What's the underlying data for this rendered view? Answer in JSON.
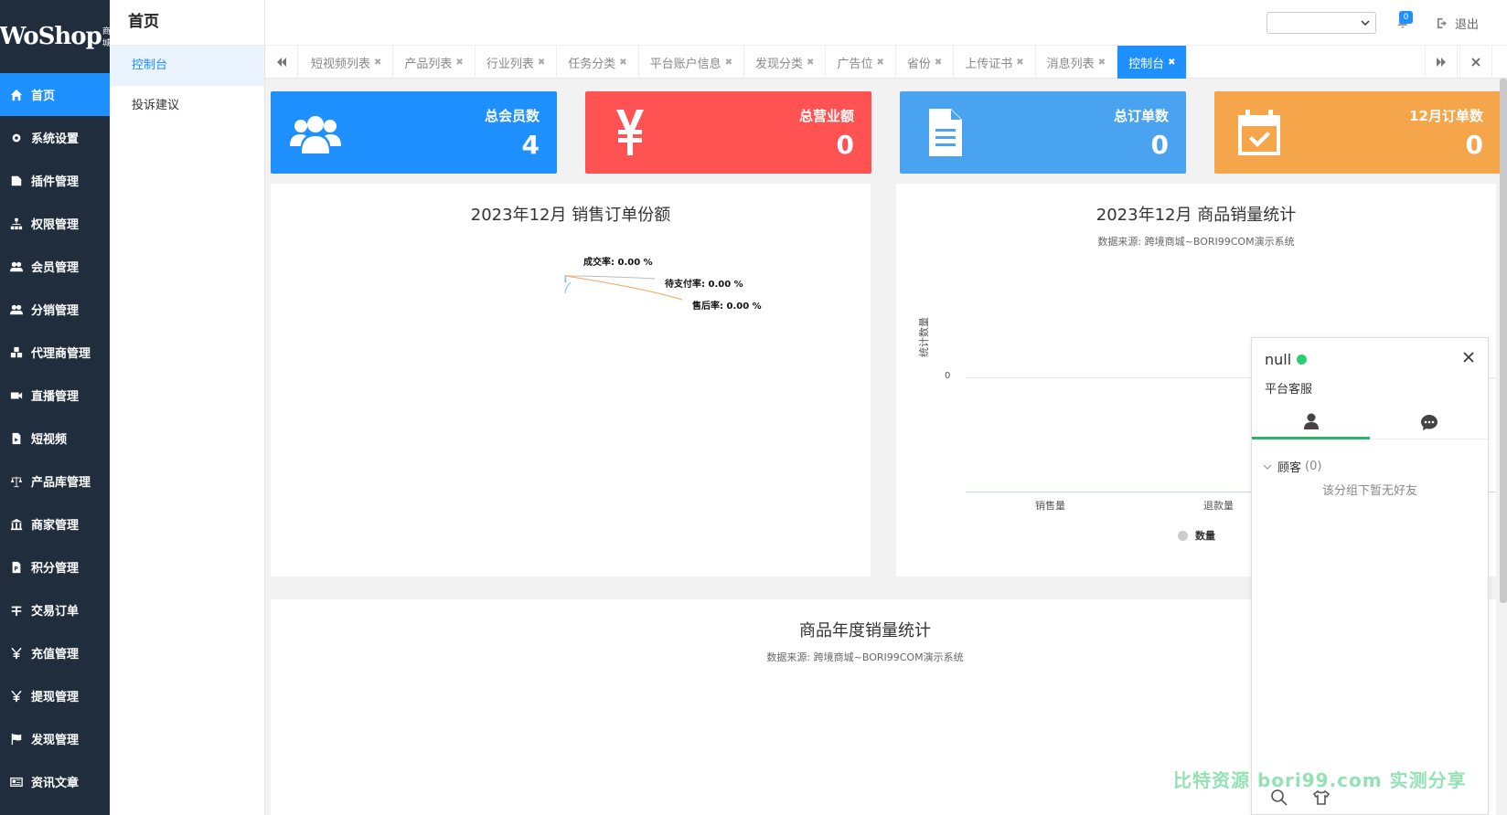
{
  "logo": {
    "text": "WoShop",
    "sub": "商城"
  },
  "sidebar": {
    "items": [
      {
        "label": "首页",
        "icon": "home-icon"
      },
      {
        "label": "系统设置",
        "icon": "gear-icon"
      },
      {
        "label": "插件管理",
        "icon": "plugin-icon"
      },
      {
        "label": "权限管理",
        "icon": "sitemap-icon"
      },
      {
        "label": "会员管理",
        "icon": "users-icon"
      },
      {
        "label": "分销管理",
        "icon": "users-icon"
      },
      {
        "label": "代理商管理",
        "icon": "cubes-icon"
      },
      {
        "label": "直播管理",
        "icon": "video-icon"
      },
      {
        "label": "短视频",
        "icon": "file-video-icon"
      },
      {
        "label": "产品库管理",
        "icon": "scale-icon"
      },
      {
        "label": "商家管理",
        "icon": "bank-icon"
      },
      {
        "label": "积分管理",
        "icon": "points-icon"
      },
      {
        "label": "交易订单",
        "icon": "order-icon"
      },
      {
        "label": "充值管理",
        "icon": "yen-icon"
      },
      {
        "label": "提现管理",
        "icon": "yen-icon"
      },
      {
        "label": "发现管理",
        "icon": "flag-icon"
      },
      {
        "label": "资讯文章",
        "icon": "news-icon"
      }
    ]
  },
  "submenu": {
    "title": "首页",
    "items": [
      {
        "label": "控制台"
      },
      {
        "label": "投诉建议"
      }
    ]
  },
  "header": {
    "select_value": "",
    "notification_count": "0",
    "logout_label": "退出"
  },
  "tabs": [
    {
      "label": "短视频列表"
    },
    {
      "label": "产品列表"
    },
    {
      "label": "行业列表"
    },
    {
      "label": "任务分类"
    },
    {
      "label": "平台账户信息"
    },
    {
      "label": "发现分类"
    },
    {
      "label": "广告位"
    },
    {
      "label": "省份"
    },
    {
      "label": "上传证书"
    },
    {
      "label": "消息列表"
    },
    {
      "label": "控制台"
    }
  ],
  "cards": [
    {
      "label": "总会员数",
      "value": "4",
      "color": "#1e90ff",
      "icon": "users-icon"
    },
    {
      "label": "总营业额",
      "value": "0",
      "color": "#ff5252",
      "icon": "yen-icon"
    },
    {
      "label": "总订单数",
      "value": "0",
      "color": "#4aa3f0",
      "icon": "document-icon"
    },
    {
      "label": "12月订单数",
      "value": "0",
      "color": "#f5a54a",
      "icon": "calendar-check-icon"
    }
  ],
  "colors": {
    "sidebar_bg": "#1f2d3d",
    "accent": "#1e90ff",
    "online": "#2ecc71"
  },
  "chart_data": [
    {
      "type": "pie",
      "title": "2023年12月 销售订单份额",
      "categories": [
        "成交率",
        "待支付率",
        "售后率"
      ],
      "values": [
        0,
        0,
        0
      ],
      "labels": [
        "成交率: 0.00 %",
        "待支付率: 0.00 %",
        "售后率: 0.00 %"
      ]
    },
    {
      "type": "bar",
      "title": "2023年12月 商品销量统计",
      "subtitle": "数据来源: 跨境商城~BORI99COM演示系统",
      "ylabel": "统计数量",
      "categories": [
        "销售量",
        "退款量"
      ],
      "series": [
        {
          "name": "数量",
          "values": [
            0,
            0
          ]
        }
      ],
      "yticks": [
        "0"
      ]
    },
    {
      "type": "line",
      "title": "商品年度销量统计",
      "subtitle": "数据来源: 跨境商城~BORI99COM演示系统"
    }
  ],
  "chat": {
    "name": "null",
    "role": "平台客服",
    "group_label": "顾客",
    "group_count": "(0)",
    "empty_note": "该分组下暂无好友"
  },
  "watermark": "比特资源 bori99.com 实测分享"
}
